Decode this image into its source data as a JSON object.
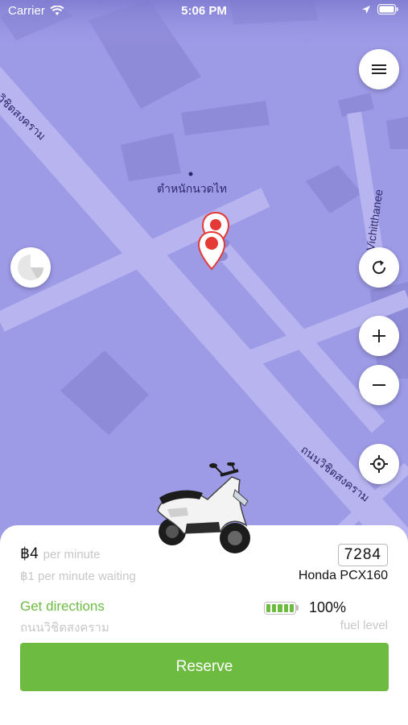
{
  "status_bar": {
    "carrier": "Carrier",
    "time": "5:06 PM"
  },
  "map": {
    "labels": {
      "place": "ตำหนักนวดไท",
      "road_left": "วิชิตสงคราม",
      "road_right": "Vichitthanee",
      "road_bottom": "ถนนวิชิตสงคราม"
    },
    "colors": {
      "map_base": "#9d9ae6",
      "road": "#b7b4f0",
      "building": "#8e8bd8",
      "pin": "#e53935"
    }
  },
  "controls": {
    "menu_icon": "hamburger-menu-icon",
    "refresh_icon": "refresh-icon",
    "zoom_in_icon": "plus-icon",
    "zoom_out_icon": "minus-icon",
    "locate_icon": "crosshair-icon",
    "compass_icon": "compass-icon"
  },
  "vehicle": {
    "price": "฿4",
    "price_unit": "per minute",
    "waiting_price": "฿1 per minute waiting",
    "plate": "7284",
    "model": "Honda PCX160",
    "directions_label": "Get directions",
    "street": "ถนนวิชิตสงคราม",
    "fuel_percent": "100%",
    "fuel_level_value": 1.0,
    "fuel_label": "fuel level",
    "reserve_label": "Reserve",
    "accent_color": "#6ebb42"
  }
}
